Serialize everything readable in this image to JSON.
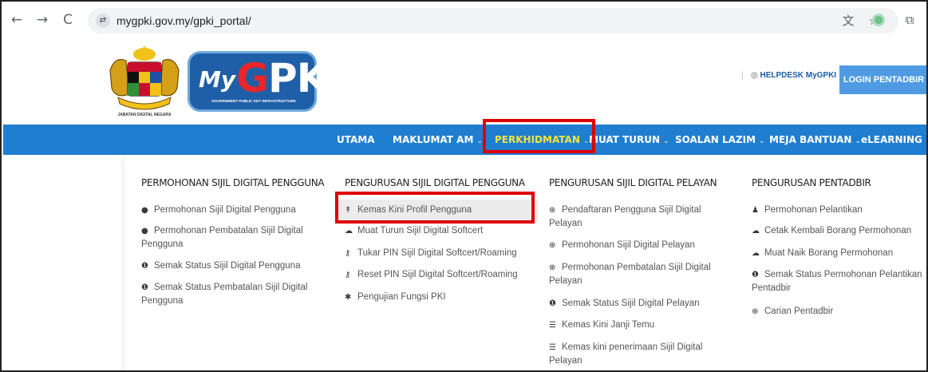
{
  "browser": {
    "back_icon": "←",
    "forward_icon": "→",
    "reload_icon": "C",
    "site_info_icon": "⇄",
    "url": "mygpki.gov.my/gpki_portal/",
    "translate_icon": "文",
    "bookmark_icon": "☆",
    "extensions_icon": "⧉"
  },
  "header": {
    "crest_caption": "JABATAN DIGITAL NEGARA",
    "logo_my": "My",
    "logo_g": "G",
    "logo_pki": "PKI",
    "logo_tagline": "GOVERNMENT PUBLIC KEY INFRASTRUCTURE",
    "helpdesk_label": "HELPDESK MyGPKI",
    "login_label": "LOGIN PENTADBIR"
  },
  "nav": {
    "items": [
      {
        "label": "UTAMA",
        "caret": ""
      },
      {
        "label": "MAKLUMAT AM",
        "caret": "⌄"
      },
      {
        "label": "PERKHIDMATAN",
        "caret": "⌄"
      },
      {
        "label": "MUAT TURUN",
        "caret": "⌄"
      },
      {
        "label": "SOALAN LAZIM",
        "caret": "⌄"
      },
      {
        "label": "MEJA BANTUAN",
        "caret": "⌄"
      },
      {
        "label": "eLEARNING",
        "caret": ""
      }
    ]
  },
  "menu": {
    "columns": [
      {
        "title": "PERMOHONAN SIJIL DIGITAL PENGGUNA",
        "items": [
          {
            "icon": "●",
            "line1": "Permohonan Sijil Digital Pengguna",
            "line2": ""
          },
          {
            "icon": "●",
            "line1": "Permohonan Pembatalan Sijil Digital",
            "line2": "Pengguna"
          },
          {
            "icon": "❶",
            "line1": "Semak Status Sijil Digital Pengguna",
            "line2": ""
          },
          {
            "icon": "❶",
            "line1": "Semak Status Pembatalan Sijil Digital",
            "line2": "Pengguna"
          }
        ]
      },
      {
        "title": "PENGURUSAN SIJIL DIGITAL PENGGUNA",
        "items": [
          {
            "icon": "↟",
            "line1": "Kemas Kini Profil Pengguna",
            "line2": ""
          },
          {
            "icon": "☁",
            "line1": "Muat Turun Sijil Digital Softcert",
            "line2": ""
          },
          {
            "icon": "⚷",
            "line1": "Tukar PIN Sijil Digital Softcert/Roaming",
            "line2": ""
          },
          {
            "icon": "⚷",
            "line1": "Reset PIN Sijil Digital Softcert/Roaming",
            "line2": ""
          },
          {
            "icon": "✱",
            "line1": "Pengujian Fungsi PKI",
            "line2": ""
          }
        ]
      },
      {
        "title": "PENGURUSAN SIJIL DIGITAL PELAYAN",
        "items": [
          {
            "icon": "⊕",
            "line1": "Pendaftaran Pengguna Sijil Digital",
            "line2": "Pelayan"
          },
          {
            "icon": "⊕",
            "line1": "Permohonan Sijil Digital Pelayan",
            "line2": ""
          },
          {
            "icon": "⊕",
            "line1": "Permohonan Pembatalan Sijil Digital",
            "line2": "Pelayan"
          },
          {
            "icon": "❶",
            "line1": "Semak Status Sijil Digital Pelayan",
            "line2": ""
          },
          {
            "icon": "☰",
            "line1": "Kemas Kini Janji Temu",
            "line2": ""
          },
          {
            "icon": "☰",
            "line1": "Kemas kini penerimaan Sijil Digital",
            "line2": "Pelayan"
          }
        ]
      },
      {
        "title": "PENGURUSAN PENTADBIR",
        "items": [
          {
            "icon": "♟",
            "line1": "Permohonan Pelantikan",
            "line2": ""
          },
          {
            "icon": "☁",
            "line1": "Cetak Kembali Borang Permohonan",
            "line2": ""
          },
          {
            "icon": "☁",
            "line1": "Muat Naik Borang Permohonan",
            "line2": ""
          },
          {
            "icon": "❶",
            "line1": "Semak Status Permohonan Pelantikan",
            "line2": "Pentadbir"
          },
          {
            "icon": "⊕",
            "line1": "Carian Pentadbir",
            "line2": ""
          }
        ]
      }
    ]
  },
  "colors": {
    "nav_bg": "#1f7ed0",
    "active_nav": "#f6e33c",
    "login_bg": "#4f9be3",
    "highlight_border": "#e00000"
  }
}
